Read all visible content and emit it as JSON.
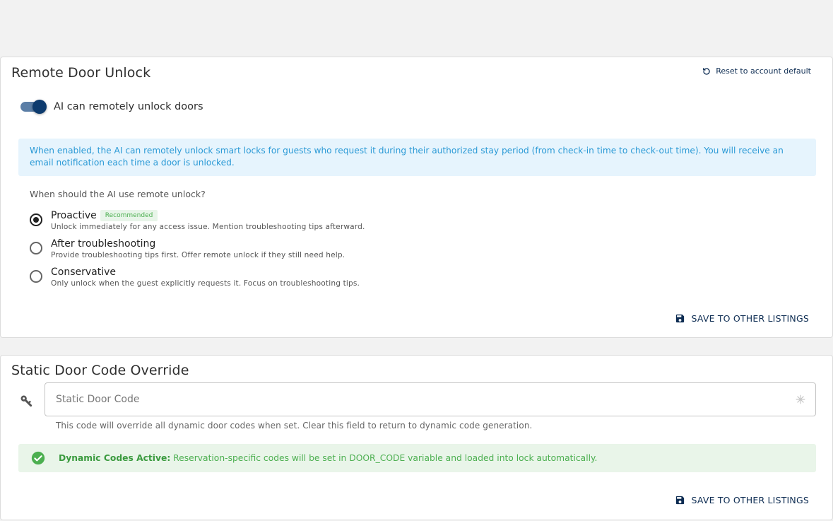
{
  "remote_unlock": {
    "title": "Remote Door Unlock",
    "reset_label": "Reset to account default",
    "toggle_label": "AI can remotely unlock doors",
    "toggle_on": true,
    "info_text": "When enabled, the AI can remotely unlock smart locks for guests who request it during their authorized stay period (from check-in time to check-out time). You will receive an email notification each time a door is unlocked.",
    "question": "When should the AI use remote unlock?",
    "options": [
      {
        "title": "Proactive",
        "badge": "Recommended",
        "description": "Unlock immediately for any access issue. Mention troubleshooting tips afterward.",
        "selected": true
      },
      {
        "title": "After troubleshooting",
        "description": "Provide troubleshooting tips first. Offer remote unlock if they still need help.",
        "selected": false
      },
      {
        "title": "Conservative",
        "description": "Only unlock when the guest explicitly requests it. Focus on troubleshooting tips.",
        "selected": false
      }
    ],
    "save_label": "SAVE TO OTHER LISTINGS"
  },
  "static_code": {
    "title": "Static Door Code Override",
    "input_placeholder": "Static Door Code",
    "input_value": "",
    "helper_text": "This code will override all dynamic door codes when set. Clear this field to return to dynamic code generation.",
    "status_label": "Dynamic Codes Active:",
    "status_text": " Reservation-specific codes will be set in DOOR_CODE variable and loaded into lock automatically.",
    "save_label": "SAVE TO OTHER LISTINGS"
  },
  "icons": {
    "reset": "refresh-icon",
    "save": "floppy-disk-icon",
    "key": "key-icon",
    "sparkle": "sparkle-icon",
    "success": "check-circle-icon"
  },
  "colors": {
    "accent": "#0d2c52",
    "toggle_thumb": "#0d3b6e",
    "toggle_track": "#5b7ea6",
    "info_bg": "#e6f4fd",
    "info_text": "#2b9ad6",
    "success_bg": "#e9f5e9",
    "success_text": "#4caf50"
  }
}
